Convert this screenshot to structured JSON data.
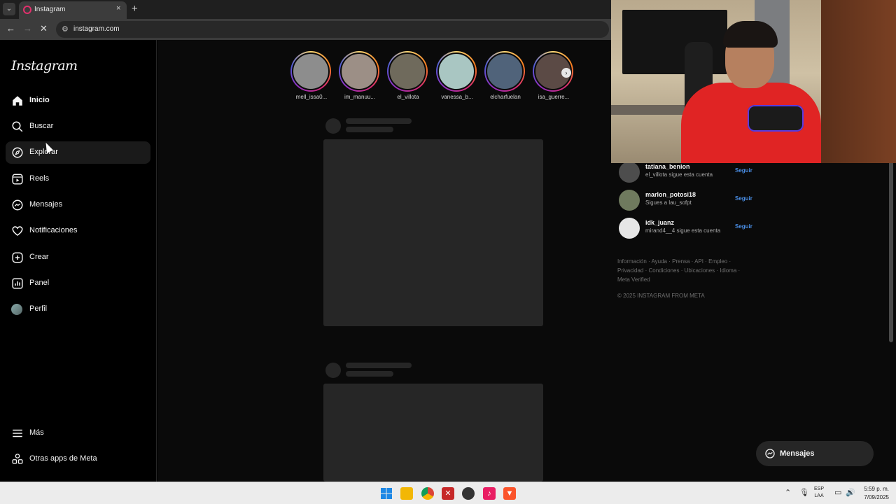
{
  "browser": {
    "tab_title": "Instagram",
    "tab_close": "×",
    "new_tab": "+",
    "url": "instagram.com"
  },
  "sidebar": {
    "logo": "Instagram",
    "items": [
      {
        "label": "Inicio",
        "icon": "home-icon"
      },
      {
        "label": "Buscar",
        "icon": "search-icon"
      },
      {
        "label": "Explorar",
        "icon": "compass-icon"
      },
      {
        "label": "Reels",
        "icon": "reels-icon"
      },
      {
        "label": "Mensajes",
        "icon": "messenger-icon"
      },
      {
        "label": "Notificaciones",
        "icon": "heart-icon"
      },
      {
        "label": "Crear",
        "icon": "plus-square-icon"
      },
      {
        "label": "Panel",
        "icon": "chart-icon"
      },
      {
        "label": "Perfil",
        "icon": "avatar"
      }
    ],
    "more": "Más",
    "meta_apps": "Otras apps de Meta"
  },
  "stories": [
    {
      "name": "mell_issa0..."
    },
    {
      "name": "im_manuu..."
    },
    {
      "name": "el_villota"
    },
    {
      "name": "vanessa_b..."
    },
    {
      "name": "elcharfuelan"
    },
    {
      "name": "isa_guerre..."
    }
  ],
  "suggestions": [
    {
      "name": "tatiana_benion",
      "sub": "el_villota sigue esta cuenta",
      "action": "Seguir"
    },
    {
      "name": "marlon_potosi18",
      "sub": "Sigues a lau_sofpt",
      "action": "Seguir"
    },
    {
      "name": "idk_juanz",
      "sub": "mirand4__4 sigue esta cuenta",
      "action": "Seguir"
    }
  ],
  "footer": {
    "links": "Información · Ayuda · Prensa · API · Empleo · Privacidad · Condiciones · Ubicaciones · Idioma · Meta Verified",
    "copyright": "© 2025 INSTAGRAM FROM META"
  },
  "messages_button": "Mensajes",
  "taskbar": {
    "lang_1": "ESP",
    "lang_2": "LAA",
    "time": "5:59 p. m.",
    "date": "7/09/2025"
  },
  "colors": {
    "accent_link": "#4a8fe7",
    "bg": "#0a0a0a",
    "placeholder": "#262626"
  }
}
